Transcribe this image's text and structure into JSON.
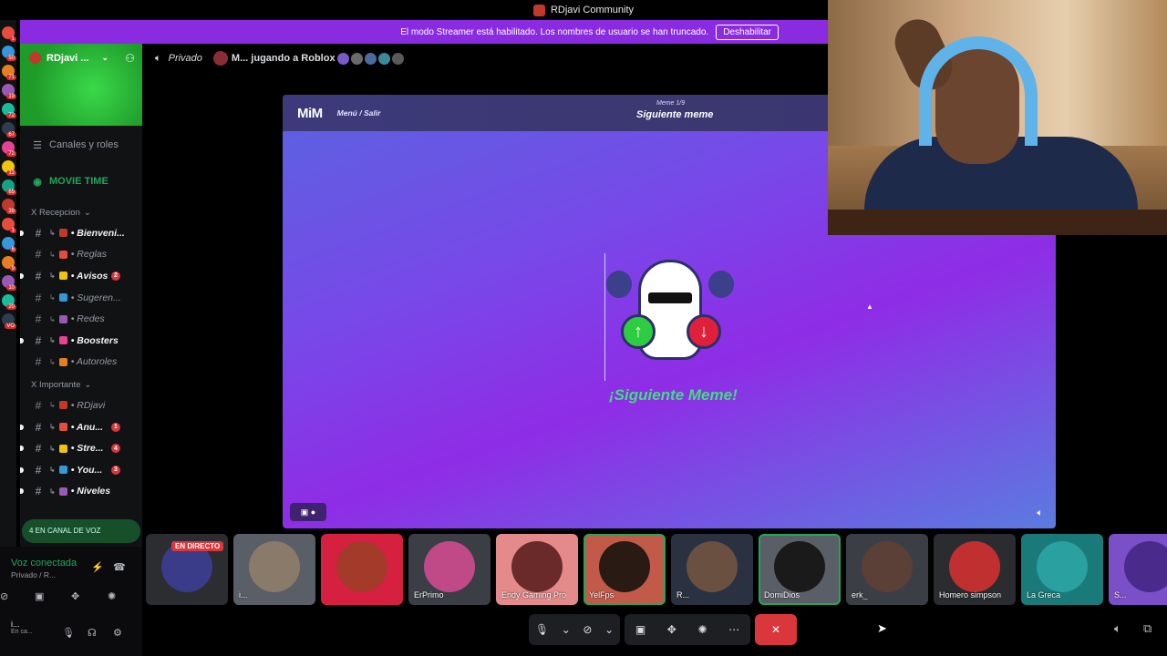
{
  "window": {
    "title": "RDjavi Community"
  },
  "banner": {
    "text": "El modo Streamer está habilitado. Los nombres de usuario se han truncado.",
    "button": "Deshabilitar"
  },
  "server_badges": [
    "1",
    "",
    "50",
    "",
    "71",
    "",
    "19",
    "",
    "72",
    "",
    "67",
    "",
    "22",
    "72",
    "",
    "12",
    "",
    "65",
    "",
    "39",
    "",
    "1",
    "",
    "6",
    "",
    "9",
    "",
    "10",
    "",
    "20",
    "",
    "VO"
  ],
  "guild": {
    "name": "RDjavi ...",
    "menu": {
      "channels_roles": "Canales y roles",
      "movie_time": "MOVIE TIME"
    }
  },
  "categories": {
    "recepcion": "X Recepcion",
    "importante": "X Importante"
  },
  "channels_recepcion": [
    {
      "name": "• Bienveni...",
      "bold": true,
      "badge": ""
    },
    {
      "name": "• Reglas",
      "bold": false,
      "badge": ""
    },
    {
      "name": "• Avisos",
      "bold": true,
      "badge": "2"
    },
    {
      "name": "• Sugeren...",
      "bold": false,
      "badge": ""
    },
    {
      "name": "• Redes",
      "bold": false,
      "badge": ""
    },
    {
      "name": "• Boosters",
      "bold": true,
      "badge": ""
    },
    {
      "name": "• Autoroles",
      "bold": false,
      "badge": ""
    }
  ],
  "channels_importante": [
    {
      "name": "• RDjavi",
      "bold": false,
      "badge": ""
    },
    {
      "name": "• Anu...",
      "bold": true,
      "badge": "1"
    },
    {
      "name": "• Stre...",
      "bold": true,
      "badge": "4"
    },
    {
      "name": "• You...",
      "bold": true,
      "badge": "3"
    },
    {
      "name": "• Niveles",
      "bold": true,
      "badge": ""
    }
  ],
  "voice_pill": "4 EN CANAL DE VOZ",
  "voice": {
    "status": "Voz conectada",
    "sub": "Privado / R...",
    "user": "i...",
    "user_sub": "En ca..."
  },
  "topbar": {
    "channel": "Privado",
    "activity": "M... jugando a Roblox"
  },
  "activity": {
    "app": "MiM",
    "menu": "Menú / Salir",
    "counter": "Meme 1/9",
    "header_title": "Siguiente meme",
    "label": "¡Siguiente Meme!"
  },
  "tiles": [
    {
      "name": "",
      "live": "EN DIRECTO",
      "color": "#2b2d31",
      "av": "#3a3c8a"
    },
    {
      "name": "i...",
      "color": "#5a5e66",
      "av": "#8a7a6a"
    },
    {
      "name": "",
      "color": "#d6203f",
      "av": "#a33a2a"
    },
    {
      "name": "ErPrimo",
      "color": "#3b3e45",
      "av": "#c04a88"
    },
    {
      "name": "Endy Gaming Pro",
      "color": "#e48a8a",
      "av": "#6a2a2a"
    },
    {
      "name": "YelFps",
      "color": "#c25a4a",
      "av": "#2a1a14"
    },
    {
      "name": "R...",
      "color": "#2a3140",
      "av": "#6a5040"
    },
    {
      "name": "DomiDios",
      "color": "#5a5e66",
      "av": "#1a1a1a"
    },
    {
      "name": "erk_",
      "color": "#3b3e45",
      "av": "#5a4036"
    },
    {
      "name": "Homero simpson",
      "color": "#2a2c30",
      "av": "#c03030"
    },
    {
      "name": "La Greca",
      "color": "#1a7a7a",
      "av": "#2aa0a0"
    },
    {
      "name": "S...",
      "color": "#7b4fc8",
      "av": "#4a2a8a"
    }
  ]
}
